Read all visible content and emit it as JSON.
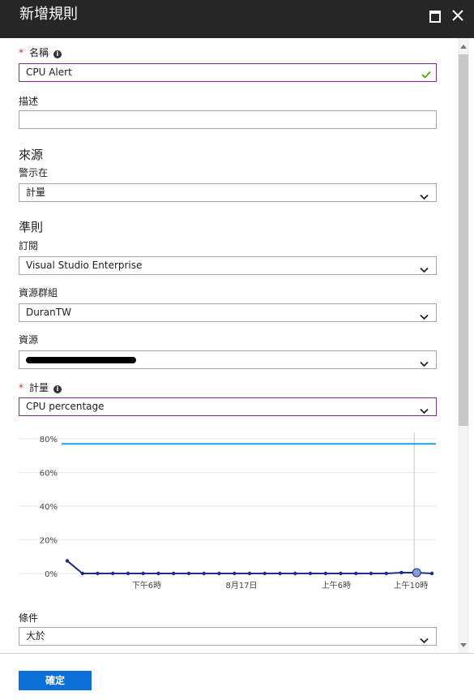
{
  "header": {
    "title": "新增規則"
  },
  "form": {
    "name": {
      "label": "名稱",
      "value": "CPU Alert"
    },
    "description": {
      "label": "描述",
      "value": ""
    },
    "source": {
      "section": "來源",
      "alert_on": {
        "label": "警示在",
        "value": "計量"
      }
    },
    "criteria": {
      "section": "準則",
      "subscription": {
        "label": "訂閱",
        "value": "Visual Studio Enterprise"
      },
      "resource_group": {
        "label": "資源群組",
        "value": "DuranTW"
      },
      "resource": {
        "label": "資源",
        "value": ""
      },
      "metric": {
        "label": "計量",
        "value": "CPU percentage"
      }
    },
    "condition": {
      "label": "條件",
      "value": "大於"
    }
  },
  "chart_data": {
    "type": "line",
    "y_ticks": [
      "80%",
      "60%",
      "40%",
      "20%",
      "0%"
    ],
    "ylim": [
      0,
      80
    ],
    "x_ticks": [
      "下午6時",
      "8月17日",
      "上午6時",
      "上午10時"
    ],
    "threshold": 77,
    "series": [
      {
        "values": [
          7.5,
          0,
          0,
          0,
          0,
          0,
          0,
          0,
          0,
          0,
          0,
          0,
          0,
          0,
          0,
          0,
          0,
          0,
          0,
          0,
          0,
          0,
          0.5,
          0.5,
          0
        ]
      }
    ],
    "colors": {
      "line": "#1f2d8c",
      "threshold": "#1ba1e2",
      "cursor": "#c8c8c8",
      "highlight": "#7ea2d6"
    }
  },
  "footer": {
    "ok_label": "確定"
  }
}
